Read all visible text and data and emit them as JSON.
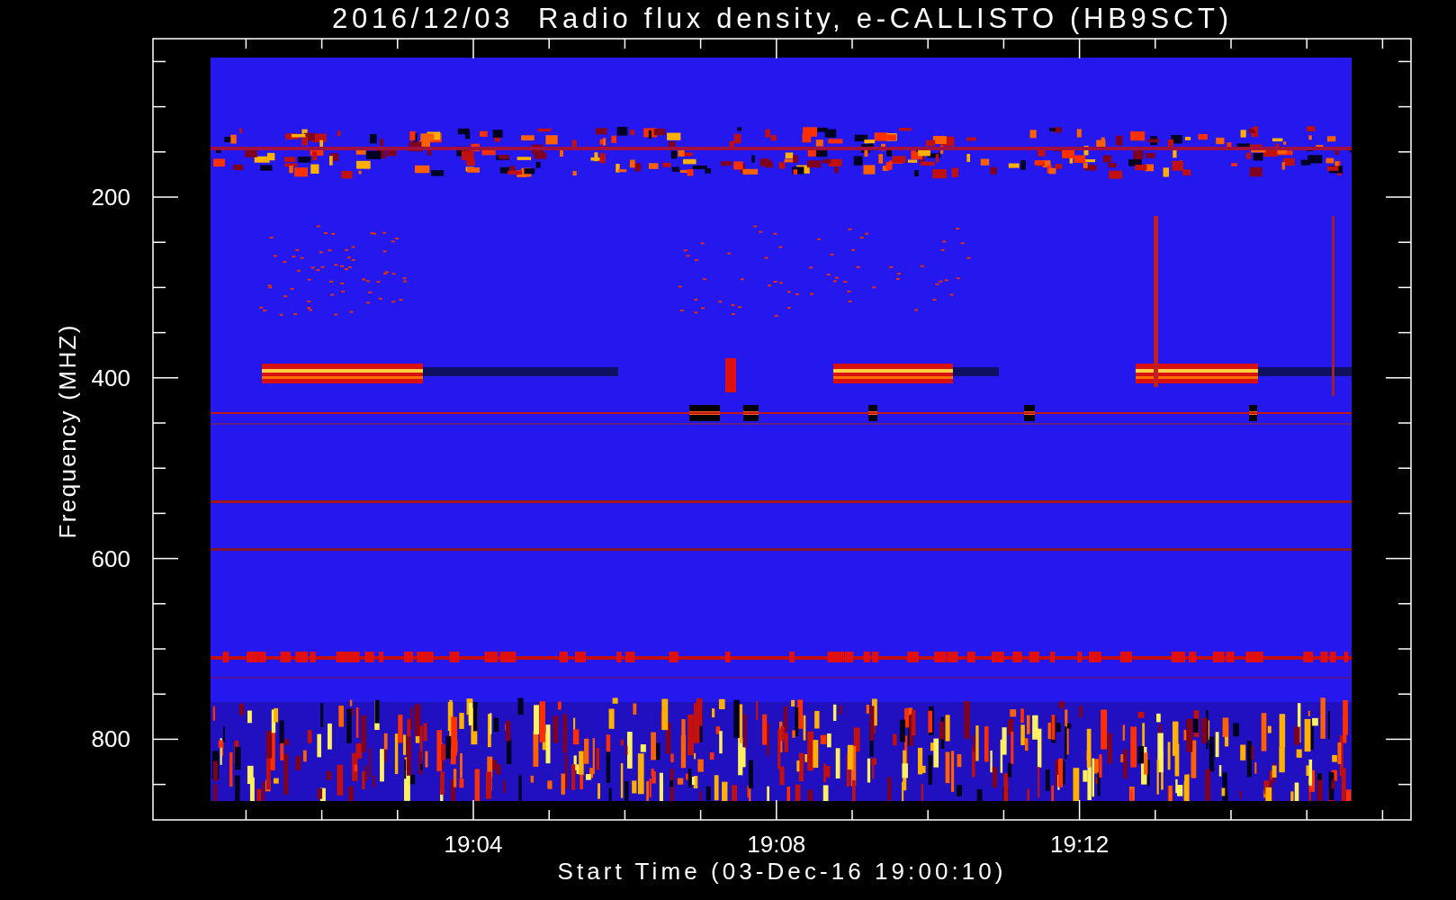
{
  "title": "2016/12/03  Radio flux density, e-CALLISTO (HB9SCT)",
  "x_axis": {
    "label": "Start Time (03-Dec-16 19:00:10)",
    "ticks": [
      "19:04",
      "19:08",
      "19:12"
    ]
  },
  "y_axis": {
    "label": "Frequency (MHZ)",
    "ticks": [
      "200",
      "400",
      "600",
      "800"
    ]
  }
}
